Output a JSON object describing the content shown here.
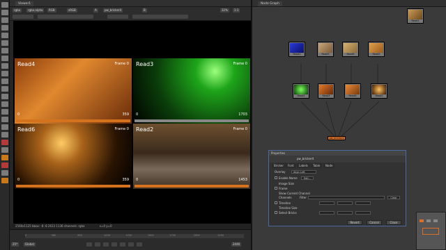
{
  "viewer": {
    "tab_label": "Viewer1",
    "channel_select": "rgba",
    "alpha_select": "rgba.alpha",
    "colorspace": "RGB",
    "lut": "sRGB",
    "input_a": "A",
    "input_node": "pw_bricker4",
    "input_b": "B",
    "zoom": "32%",
    "proxy": "1:1"
  },
  "cells": [
    {
      "label": "Read4",
      "frame": "Frame 0",
      "start": "0",
      "end": "359",
      "bar_color": "#d5721e",
      "bar_fill": 1.0,
      "gradient": "linear-gradient(135deg, #8b3c0b 0%, #e0882f 40%, #6a2b09 100%)"
    },
    {
      "label": "Read3",
      "frame": "Frame 0",
      "start": "0",
      "end": "1703",
      "bar_color": "#888888",
      "bar_fill": 1.0,
      "gradient": "radial-gradient(circle at 70% 20%, #9bff7c 0%, #1ea51a 20%, #0b3d0a 60%, #000 100%)"
    },
    {
      "label": "Read6",
      "frame": "Frame 0",
      "start": "0",
      "end": "359",
      "bar_color": "#d5721e",
      "bar_fill": 1.0,
      "gradient": "radial-gradient(circle at 40% 30%, #ffcb64 0%, #a8621a 25%, #2a1402 65%, #000 100%)"
    },
    {
      "label": "Read2",
      "frame": "Frame 0",
      "start": "0",
      "end": "1453",
      "bar_color": "#d5721e",
      "bar_fill": 1.0,
      "gradient": "linear-gradient(180deg, #6e5030 0%, #3a2a1c 45%, #7a6a5a 70%, #3d2f22 100%)"
    }
  ],
  "viewer_status": "2560x1125  bbox: -8 -8 2613 1136 channels: rgba",
  "viewer_coords": "x=0 y=0",
  "timeline": {
    "fps_label": "25*",
    "mode": "Global",
    "current_frame": "2446",
    "ticks": [
      "0",
      "360",
      "650",
      "1000",
      "1250",
      "1500",
      "1750",
      "2000",
      "2250"
    ]
  },
  "nodegraph": {
    "tab_label": "Node Graph",
    "top_node": "Read1",
    "nodes_row1": [
      "Read4",
      "Read3",
      "Read6",
      "Read2"
    ],
    "nodes_row2": [
      "Read4",
      "Read3",
      "Read6",
      "Read2"
    ],
    "merge_label": "pw_bricker4"
  },
  "properties": {
    "title": "Properties",
    "node_name": "pw_bricker4",
    "tabs": [
      "Bricker",
      "Font",
      "Labels",
      "Table",
      "Node"
    ],
    "overlay_label": "Overlay",
    "overlay_value": "Align Left",
    "enable_label": "Enable Name",
    "enable_button": "Edit...",
    "image_size_label": "Image Size",
    "frame_label": "Frame",
    "show_current_label": "Show Current Channel",
    "channels_label": "Channels",
    "filter_label": "Filter",
    "clear_button": "Clear",
    "timeline_label": "Timeline",
    "timeline_size_label": "Timeline Size",
    "select_bricks_label": "Select Bricks",
    "buttons": [
      "Revert",
      "Cancel",
      "Close"
    ]
  }
}
